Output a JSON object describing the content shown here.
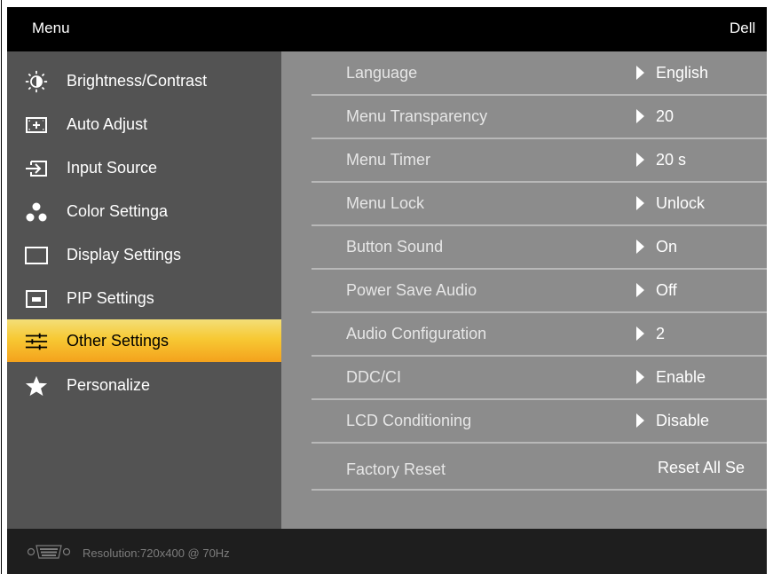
{
  "header": {
    "title": "Menu",
    "brand": "Dell"
  },
  "menu": {
    "items": [
      {
        "label": "Brightness/Contrast",
        "icon": "brightness-icon"
      },
      {
        "label": "Auto Adjust",
        "icon": "auto-adjust-icon"
      },
      {
        "label": "Input Source",
        "icon": "input-source-icon"
      },
      {
        "label": "Color Settinga",
        "icon": "color-settings-icon"
      },
      {
        "label": "Display Settings",
        "icon": "display-settings-icon"
      },
      {
        "label": "PIP Settings",
        "icon": "pip-icon"
      },
      {
        "label": "Other Settings",
        "icon": "sliders-icon",
        "selected": true
      },
      {
        "label": "Personalize",
        "icon": "star-icon"
      }
    ]
  },
  "settings": {
    "rows": [
      {
        "name": "Language",
        "value": "English"
      },
      {
        "name": "Menu Transparency",
        "value": "20"
      },
      {
        "name": "Menu Timer",
        "value": "20 s"
      },
      {
        "name": "Menu Lock",
        "value": "Unlock"
      },
      {
        "name": "Button Sound",
        "value": "On"
      },
      {
        "name": "Power Save Audio",
        "value": "Off"
      },
      {
        "name": "Audio Configuration",
        "value": "2"
      },
      {
        "name": "DDC/CI",
        "value": "Enable"
      },
      {
        "name": "LCD Conditioning",
        "value": "Disable"
      },
      {
        "name": "Factory Reset",
        "value": "Reset All Se"
      }
    ]
  },
  "footer": {
    "resolution": "Resolution:720x400 @ 70Hz",
    "icon": "vga-connector-icon"
  },
  "colors": {
    "selected_highlight": "#f7c934",
    "left_panel": "#535353",
    "right_panel": "#8c8c8c"
  }
}
